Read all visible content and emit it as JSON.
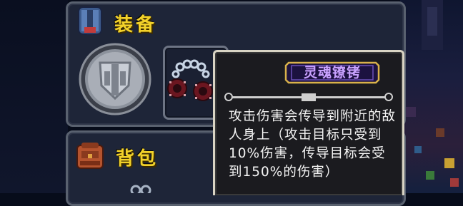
{
  "equipment": {
    "title": "装备"
  },
  "bag": {
    "title": "背包"
  },
  "tooltip": {
    "item_name": "灵魂镣铐",
    "description": "攻击伤害会传导到附近的敌人身上（攻击目标只受到10%伤害，传导目标会受到150%的伤害）"
  },
  "colors": {
    "title_yellow": "#f3d22a",
    "item_name_purple": "#c9a3ff",
    "tooltip_bg": "#1b1b1f",
    "panel_bg": "#1e2538"
  },
  "icons": [
    "helmet-icon",
    "backpack-icon",
    "shield-emblem-icon",
    "soul-shackles-icon"
  ]
}
